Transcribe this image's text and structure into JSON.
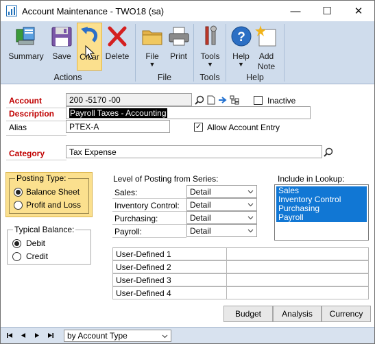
{
  "window": {
    "title": "Account Maintenance  -  TWO18 (sa)",
    "minimize_glyph": "—",
    "maximize_glyph": "☐",
    "close_glyph": "✕"
  },
  "ribbon": {
    "groups": [
      {
        "label": "Actions"
      },
      {
        "label": "File"
      },
      {
        "label": "Tools"
      },
      {
        "label": "Help"
      }
    ],
    "buttons": {
      "summary": "Summary",
      "save": "Save",
      "clear": "Clear",
      "delete": "Delete",
      "file": "File",
      "print": "Print",
      "tools": "Tools",
      "help": "Help",
      "add_note_line1": "Add",
      "add_note_line2": "Note",
      "dropdown_arrow": "▼"
    }
  },
  "form": {
    "account_label": "Account",
    "account_value": "200 -5170 -00",
    "inactive_label": "Inactive",
    "inactive_checked": false,
    "description_label": "Description",
    "description_value": "Payroll Taxes - Accounting",
    "alias_label": "Alias",
    "alias_value": "PTEX-A",
    "allow_entry_label": "Allow Account Entry",
    "allow_entry_checked": true,
    "allow_entry_mark": "✓",
    "category_label": "Category",
    "category_value": "Tax Expense"
  },
  "posting_type": {
    "title": "Posting Type:",
    "options": [
      "Balance Sheet",
      "Profit and Loss"
    ],
    "selected": "Balance Sheet"
  },
  "typical_balance": {
    "title": "Typical Balance:",
    "options": [
      "Debit",
      "Credit"
    ],
    "selected": "Debit"
  },
  "level_of_posting": {
    "title": "Level of Posting from Series:",
    "rows": [
      {
        "label": "Sales:",
        "value": "Detail"
      },
      {
        "label": "Inventory Control:",
        "value": "Detail"
      },
      {
        "label": "Purchasing:",
        "value": "Detail"
      },
      {
        "label": "Payroll:",
        "value": "Detail"
      }
    ]
  },
  "include_in_lookup": {
    "title": "Include in Lookup:",
    "items": [
      "Sales",
      "Inventory Control",
      "Purchasing",
      "Payroll"
    ]
  },
  "user_defined": {
    "rows": [
      {
        "label": "User-Defined 1",
        "value": ""
      },
      {
        "label": "User-Defined 2",
        "value": ""
      },
      {
        "label": "User-Defined 3",
        "value": ""
      },
      {
        "label": "User-Defined 4",
        "value": ""
      }
    ]
  },
  "buttons": {
    "budget": "Budget",
    "analysis": "Analysis",
    "currency": "Currency"
  },
  "statusbar": {
    "sort_value": "by Account Type"
  },
  "colors": {
    "ribbon_bg": "#cfdcec",
    "posting_type_bg": "#fbe08e",
    "required_label": "#c00000",
    "lookup_selection": "#1177d4"
  }
}
